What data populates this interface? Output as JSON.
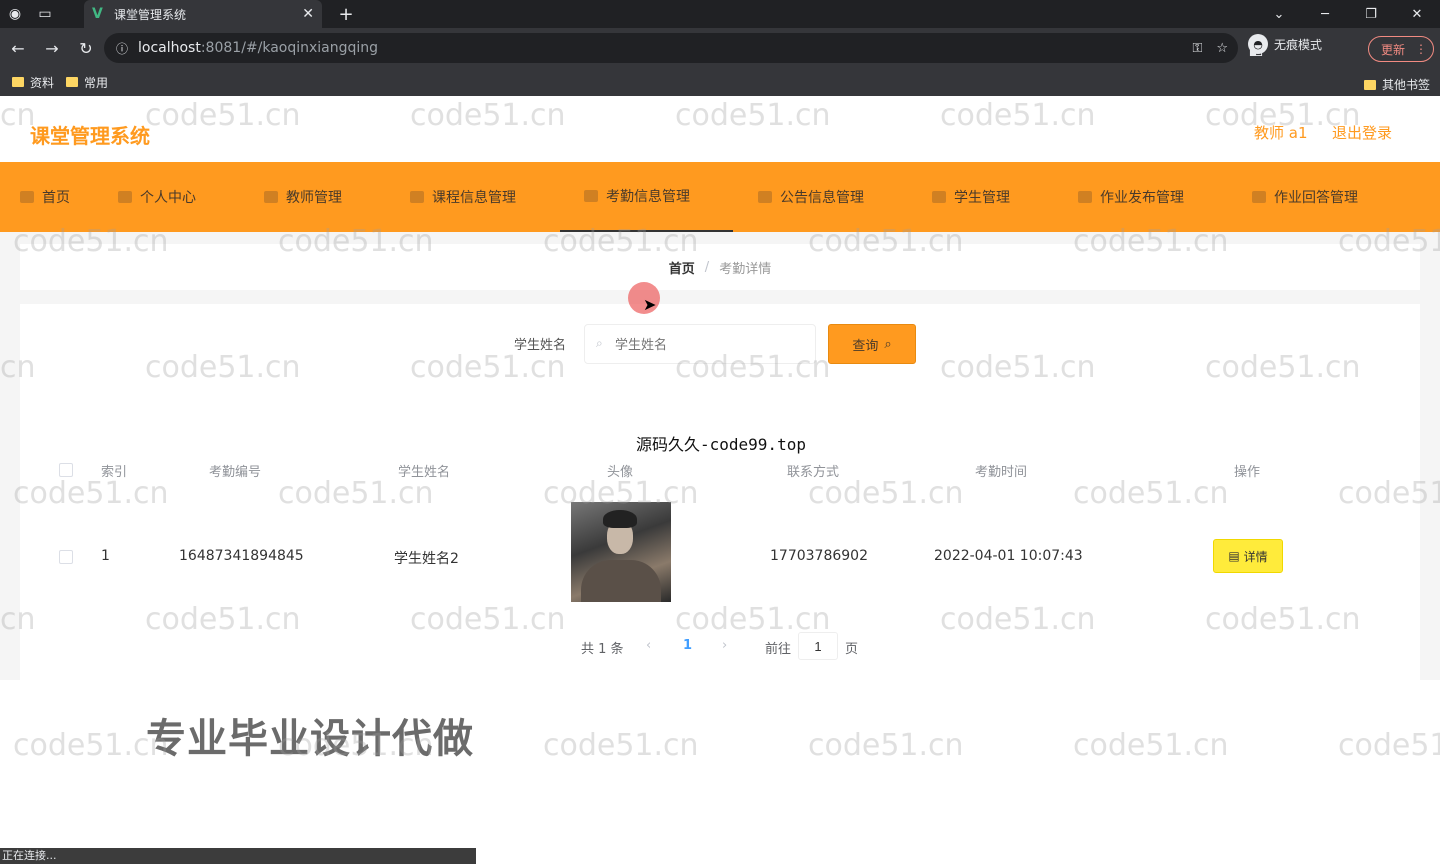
{
  "browser": {
    "tab_title": "课堂管理系统",
    "tab_close": "✕",
    "new_tab": "+",
    "url_host": "localhost",
    "url_rest": ":8081/#/kaoqinxiangqing",
    "incognito_label": "无痕模式",
    "update_label": "更新",
    "bookmarks": [
      "资料",
      "常用"
    ],
    "other_bookmarks": "其他书签",
    "status": "正在连接..."
  },
  "header": {
    "title": "课堂管理系统",
    "user": "教师 a1",
    "logout": "退出登录"
  },
  "nav": {
    "items": [
      "首页",
      "个人中心",
      "教师管理",
      "课程信息管理",
      "考勤信息管理",
      "公告信息管理",
      "学生管理",
      "作业发布管理",
      "作业回答管理"
    ],
    "active_index": 4
  },
  "breadcrumb": {
    "home": "首页",
    "separator": "/",
    "current": "考勤详情"
  },
  "search": {
    "label": "学生姓名",
    "placeholder": "学生姓名",
    "button": "查询"
  },
  "overlay_text": "源码久久-code99.top",
  "table": {
    "headers": [
      "索引",
      "考勤编号",
      "学生姓名",
      "头像",
      "联系方式",
      "考勤时间",
      "操作"
    ],
    "rows": [
      {
        "index": "1",
        "code": "16487341894845",
        "name": "学生姓名2",
        "phone": "17703786902",
        "time": "2022-04-01 10:07:43",
        "action": "详情"
      }
    ]
  },
  "pagination": {
    "total": "共 1 条",
    "prev": "‹",
    "page": "1",
    "next": "›",
    "goto": "前往",
    "goto_value": "1",
    "unit": "页"
  },
  "promo": "专业毕业设计代做",
  "watermark": "code51.cn",
  "colors": {
    "accent": "#ff9a1f",
    "detail_button": "#ffeb3b"
  }
}
